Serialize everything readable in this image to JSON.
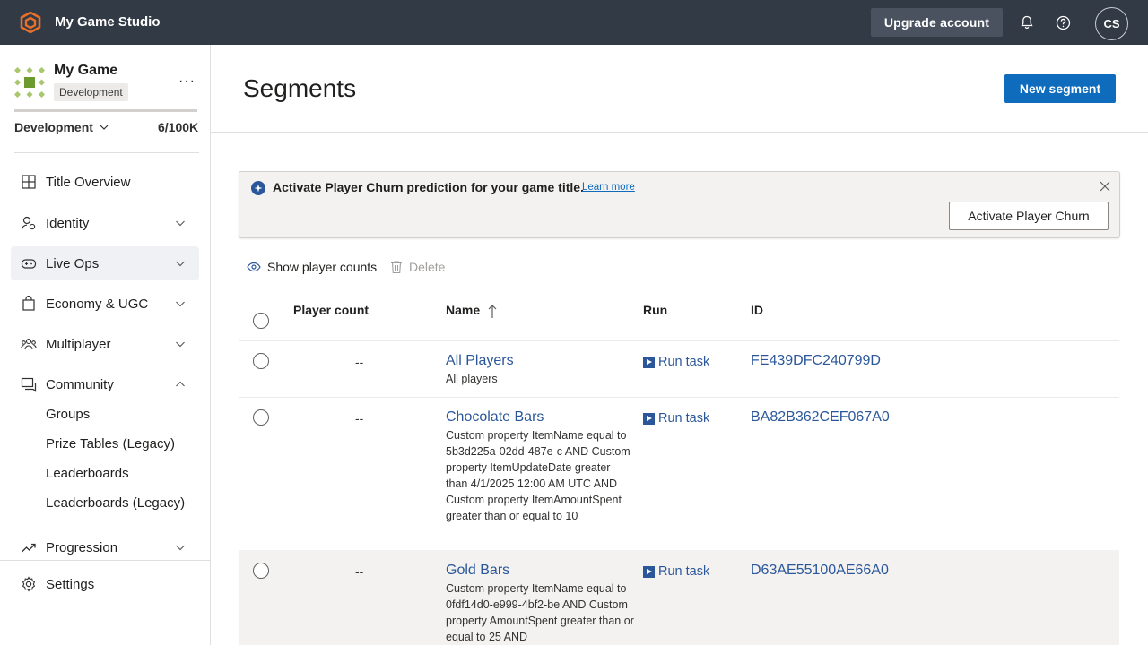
{
  "topbar": {
    "studio_name": "My Game Studio",
    "upgrade_label": "Upgrade account",
    "avatar_initials": "CS",
    "bg_color": "#323a46",
    "logo_color": "#e8702a"
  },
  "sidebar": {
    "game_name": "My Game",
    "env_badge": "Development",
    "env_selector": "Development",
    "player_usage": "6/100K",
    "nav": [
      {
        "label": "Title Overview",
        "icon": "grid-icon"
      },
      {
        "label": "Identity",
        "icon": "identity-icon"
      },
      {
        "label": "Live Ops",
        "icon": "gamepad-icon"
      },
      {
        "label": "Economy & UGC",
        "icon": "store-icon"
      },
      {
        "label": "Multiplayer",
        "icon": "people-icon"
      },
      {
        "label": "Community",
        "icon": "chat-icon"
      },
      {
        "label": "Progression",
        "icon": "trend-icon"
      }
    ],
    "community_sub": [
      "Groups",
      "Prize Tables (Legacy)",
      "Leaderboards",
      "Leaderboards (Legacy)"
    ],
    "settings_label": "Settings",
    "active_bg": "#eff1f4"
  },
  "main": {
    "title": "Segments",
    "new_segment_label": "New segment",
    "banner": {
      "text": "Activate Player Churn prediction for your game title.",
      "learn_more": "Learn more",
      "activate_label": "Activate Player Churn"
    },
    "commands": {
      "show_counts": "Show player counts",
      "delete": "Delete"
    },
    "columns": {
      "player_count": "Player count",
      "name": "Name",
      "run": "Run",
      "id": "ID"
    },
    "rows": [
      {
        "count": "--",
        "name": "All Players",
        "desc": "All players",
        "run": "Run task",
        "id": "FE439DFC240799D"
      },
      {
        "count": "--",
        "name": "Chocolate Bars",
        "desc": "Custom property ItemName equal to 5b3d225a-02dd-487e-c AND Custom property ItemUpdateDate greater than 4/1/2025 12:00 AM UTC AND Custom property ItemAmountSpent greater than or equal to 10",
        "run": "Run task",
        "id": "BA82B362CEF067A0"
      },
      {
        "count": "--",
        "name": "Gold Bars",
        "desc": "Custom property ItemName equal to 0fdf14d0-e999-4bf2-be AND Custom property AmountSpent greater than or equal to 25 AND",
        "run": "Run task",
        "id": "D63AE55100AE66A0"
      }
    ],
    "accent_color": "#0f6cbd",
    "link_color": "#2b579a"
  }
}
